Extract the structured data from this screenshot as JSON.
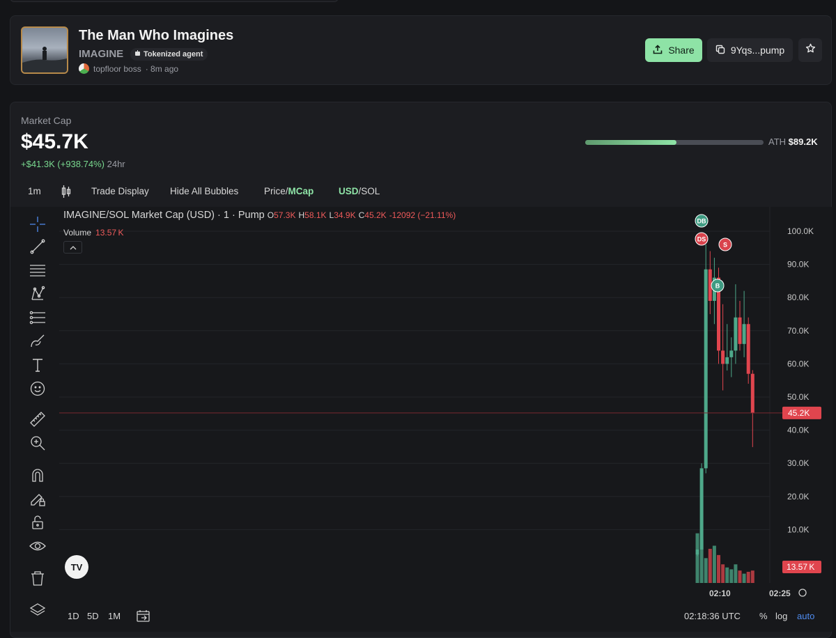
{
  "header": {
    "title": "The Man Who Imagines",
    "ticker": "IMAGINE",
    "badge": "Tokenized agent",
    "creator": "topfloor boss",
    "created_ago": "· 8m ago",
    "share_label": "Share",
    "contract_label": "9Yqs...pump"
  },
  "market": {
    "label": "Market Cap",
    "value": "$45.7K",
    "change": "+$41.3K (+938.74%)",
    "change_period": "24hr",
    "ath_label": "ATH",
    "ath_value": "$89.2K",
    "ath_progress": 0.51
  },
  "toolbar": {
    "interval": "1m",
    "trade_display": "Trade Display",
    "hide_bubbles": "Hide All Bubbles",
    "price_label": "Price/",
    "mcap_label": "MCap",
    "usd_label": "USD",
    "sol_label": "/SOL"
  },
  "chart_header": {
    "symbol": "IMAGINE/SOL Market Cap (USD) · 1 · Pump",
    "o_label": "O",
    "o_value": "57.3K",
    "h_label": "H",
    "h_value": "58.1K",
    "l_label": "L",
    "l_value": "34.9K",
    "c_label": "C",
    "c_value": "45.2K",
    "change": "-12092 (−21.11%)",
    "volume_label": "Volume",
    "volume_value": "13.57 K"
  },
  "bottom": {
    "range_1d": "1D",
    "range_5d": "5D",
    "range_1m": "1M",
    "time": "02:18:36 UTC",
    "percent": "%",
    "log": "log",
    "auto": "auto"
  },
  "colors": {
    "up": "#4ea88a",
    "down": "#e0454e",
    "accent": "#8ee3a6"
  },
  "chart_data": {
    "type": "candlestick",
    "y_axis_ticks": [
      "100.0K",
      "90.0K",
      "80.0K",
      "70.0K",
      "60.0K",
      "50.0K",
      "40.0K",
      "30.0K",
      "20.0K",
      "10.0K"
    ],
    "x_axis_ticks": [
      "02:10",
      "02:25"
    ],
    "last_price_label": "45.2K",
    "last_volume_label": "13.57 K",
    "candles": [
      {
        "o": 2.5,
        "h": 4,
        "l": 2,
        "c": 4,
        "v": 0.8
      },
      {
        "o": 4,
        "h": 30,
        "l": 4,
        "c": 28.5,
        "v": 0.7
      },
      {
        "o": 28.5,
        "h": 96,
        "l": 27,
        "c": 88.5,
        "v": 0.4
      },
      {
        "o": 88.5,
        "h": 94,
        "l": 75,
        "c": 79,
        "v": 0.55
      },
      {
        "o": 79,
        "h": 92,
        "l": 72,
        "c": 86,
        "v": 0.6
      },
      {
        "o": 86,
        "h": 89,
        "l": 60,
        "c": 64,
        "v": 0.45
      },
      {
        "o": 64,
        "h": 78,
        "l": 52,
        "c": 60,
        "v": 0.3
      },
      {
        "o": 60,
        "h": 72,
        "l": 58,
        "c": 62,
        "v": 0.25
      },
      {
        "o": 62,
        "h": 68,
        "l": 56,
        "c": 64,
        "v": 0.22
      },
      {
        "o": 64,
        "h": 84,
        "l": 60,
        "c": 74,
        "v": 0.3
      },
      {
        "o": 74,
        "h": 79,
        "l": 64,
        "c": 66,
        "v": 0.2
      },
      {
        "o": 66,
        "h": 82,
        "l": 62,
        "c": 72,
        "v": 0.15
      },
      {
        "o": 72,
        "h": 74,
        "l": 54,
        "c": 57,
        "v": 0.18
      },
      {
        "o": 57,
        "h": 58.1,
        "l": 34.9,
        "c": 45.2,
        "v": 0.2
      }
    ],
    "markers": [
      {
        "label": "DB",
        "candle": 2,
        "type": "buy"
      },
      {
        "label": "DS",
        "candle": 2,
        "type": "sell"
      },
      {
        "label": "S",
        "candle": 8,
        "type": "sell"
      },
      {
        "label": "B",
        "candle": 5,
        "type": "buy"
      }
    ]
  }
}
